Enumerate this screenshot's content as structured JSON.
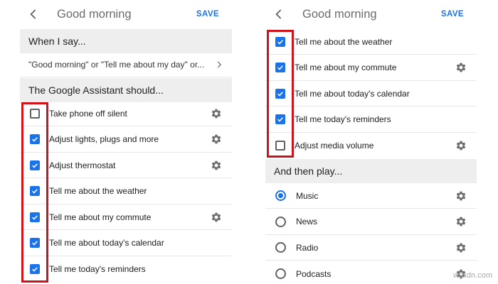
{
  "colors": {
    "accent": "#1a73e8",
    "highlight": "#d0131b",
    "section_bg": "#eeeeee"
  },
  "left": {
    "title": "Good morning",
    "save": "SAVE",
    "when_header": "When I say...",
    "trigger_text": "\"Good morning\" or \"Tell me about my day\" or...",
    "assistant_header": "The Google Assistant should...",
    "actions": [
      {
        "label": "Take phone off silent",
        "checked": false,
        "settings_icon": true
      },
      {
        "label": "Adjust lights, plugs and more",
        "checked": true,
        "settings_icon": true
      },
      {
        "label": "Adjust thermostat",
        "checked": true,
        "settings_icon": true
      },
      {
        "label": "Tell me about the weather",
        "checked": true,
        "settings_icon": false
      },
      {
        "label": "Tell me about my commute",
        "checked": true,
        "settings_icon": true
      },
      {
        "label": "Tell me about today's calendar",
        "checked": true,
        "settings_icon": false
      },
      {
        "label": "Tell me today's reminders",
        "checked": true,
        "settings_icon": false
      }
    ]
  },
  "right": {
    "title": "Good morning",
    "save": "SAVE",
    "actions": [
      {
        "label": "Tell me about the weather",
        "checked": true,
        "settings_icon": false
      },
      {
        "label": "Tell me about my commute",
        "checked": true,
        "settings_icon": true
      },
      {
        "label": "Tell me about today's calendar",
        "checked": true,
        "settings_icon": false
      },
      {
        "label": "Tell me today's reminders",
        "checked": true,
        "settings_icon": false
      },
      {
        "label": "Adjust media volume",
        "checked": false,
        "settings_icon": true
      }
    ],
    "then_header": "And then play...",
    "media": [
      {
        "label": "Music",
        "selected": true,
        "settings_icon": true
      },
      {
        "label": "News",
        "selected": false,
        "settings_icon": true
      },
      {
        "label": "Radio",
        "selected": false,
        "settings_icon": true
      },
      {
        "label": "Podcasts",
        "selected": false,
        "settings_icon": true
      }
    ]
  },
  "watermark": "wsxdn.com"
}
